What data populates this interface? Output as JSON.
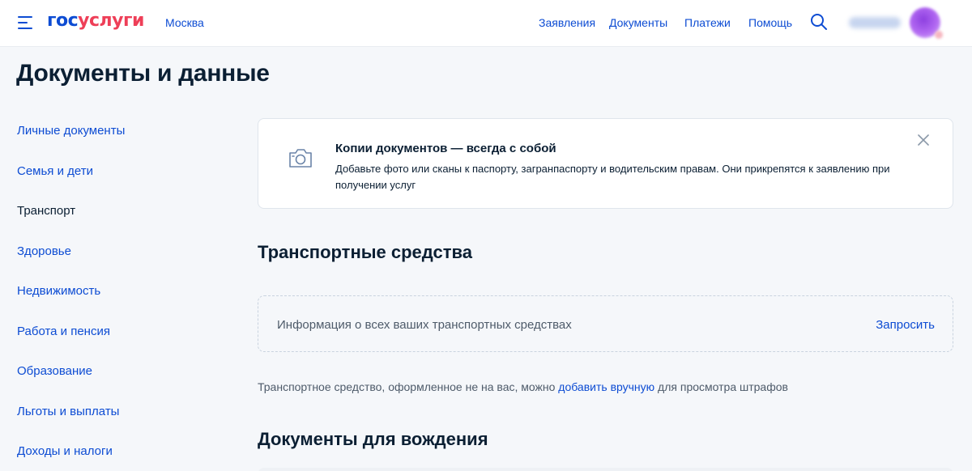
{
  "header": {
    "logo_part1": "гос",
    "logo_part2": "услуги",
    "city": "Москва",
    "nav": [
      "Заявления",
      "Документы",
      "Платежи",
      "Помощь"
    ],
    "search_icon": "search-icon",
    "menu_icon": "burger-menu-icon"
  },
  "page": {
    "title": "Документы и данные"
  },
  "sidebar": {
    "items": [
      {
        "label": "Личные документы",
        "active": false
      },
      {
        "label": "Семья и дети",
        "active": false
      },
      {
        "label": "Транспорт",
        "active": true
      },
      {
        "label": "Здоровье",
        "active": false
      },
      {
        "label": "Недвижимость",
        "active": false
      },
      {
        "label": "Работа и пенсия",
        "active": false
      },
      {
        "label": "Образование",
        "active": false
      },
      {
        "label": "Льготы и выплаты",
        "active": false
      },
      {
        "label": "Доходы и налоги",
        "active": false
      }
    ]
  },
  "banner": {
    "icon": "camera-icon",
    "title": "Копии документов — всегда с собой",
    "text": "Добавьте фото или сканы к паспорту, загранпаспорту и водительским правам. Они прикрепятся к заявлению при получении услуг",
    "close_icon": "close-icon"
  },
  "vehicles": {
    "title": "Транспортные средства",
    "request_text": "Информация о всех ваших транспортных средствах",
    "request_button": "Запросить",
    "note_before": "Транспортное средство, оформленное не на вас, можно ",
    "note_link": "добавить вручную",
    "note_after": " для просмотра штрафов"
  },
  "driving": {
    "title": "Документы для вождения"
  },
  "colors": {
    "brand_blue": "#0d4cd3",
    "brand_red": "#ee3f58",
    "text_dark": "#0b1f33",
    "text_secondary": "#4e5b6a",
    "page_bg": "#f5f7fa"
  }
}
